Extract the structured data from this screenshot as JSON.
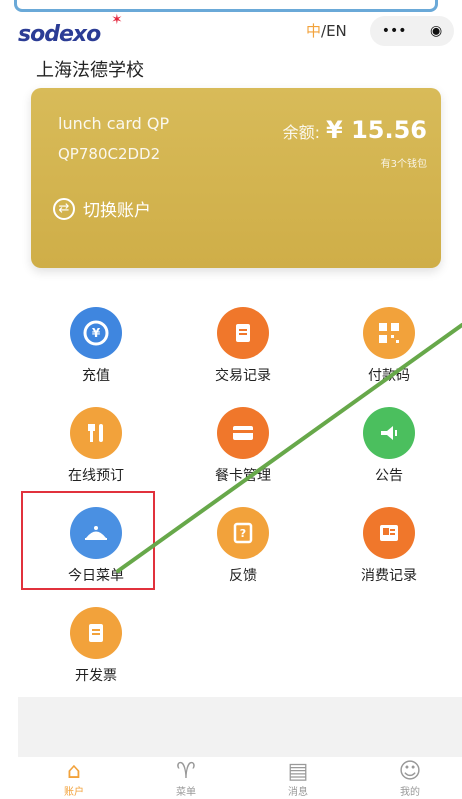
{
  "header": {
    "logo": "sodexo",
    "lang": {
      "active": "中",
      "rest": "/EN"
    },
    "capsule": {
      "more": "•••",
      "target": "◉"
    }
  },
  "school": "上海法德学校",
  "card": {
    "label": "lunch card QP",
    "id": "QP780C2DD2",
    "balance_prefix": "余额:",
    "balance": "¥ 15.56",
    "wallets": "有3个钱包",
    "switch_label": "切换账户"
  },
  "actions": [
    {
      "label": "充值",
      "icon": "recharge-icon"
    },
    {
      "label": "交易记录",
      "icon": "transaction-icon"
    },
    {
      "label": "付款码",
      "icon": "qr-code-icon"
    },
    {
      "label": "在线预订",
      "icon": "fork-knife-icon"
    },
    {
      "label": "餐卡管理",
      "icon": "card-icon"
    },
    {
      "label": "公告",
      "icon": "announcement-icon"
    },
    {
      "label": "今日菜单",
      "icon": "cloche-icon"
    },
    {
      "label": "反馈",
      "icon": "feedback-icon"
    },
    {
      "label": "消费记录",
      "icon": "record-icon"
    },
    {
      "label": "开发票",
      "icon": "invoice-icon"
    }
  ],
  "bottom_nav": [
    {
      "label": "账户",
      "icon": "home-icon"
    },
    {
      "label": "菜单",
      "icon": "menu-icon"
    },
    {
      "label": "消息",
      "icon": "message-icon"
    },
    {
      "label": "我的",
      "icon": "user-icon"
    }
  ],
  "colors": {
    "blue": "#4a90e2",
    "orange": "#f0772b",
    "amber": "#f2a23b",
    "green": "#4bbf5e",
    "card_gold": "#d4b453",
    "highlight_red": "#e1313c",
    "annotation_green": "#67a84a"
  }
}
